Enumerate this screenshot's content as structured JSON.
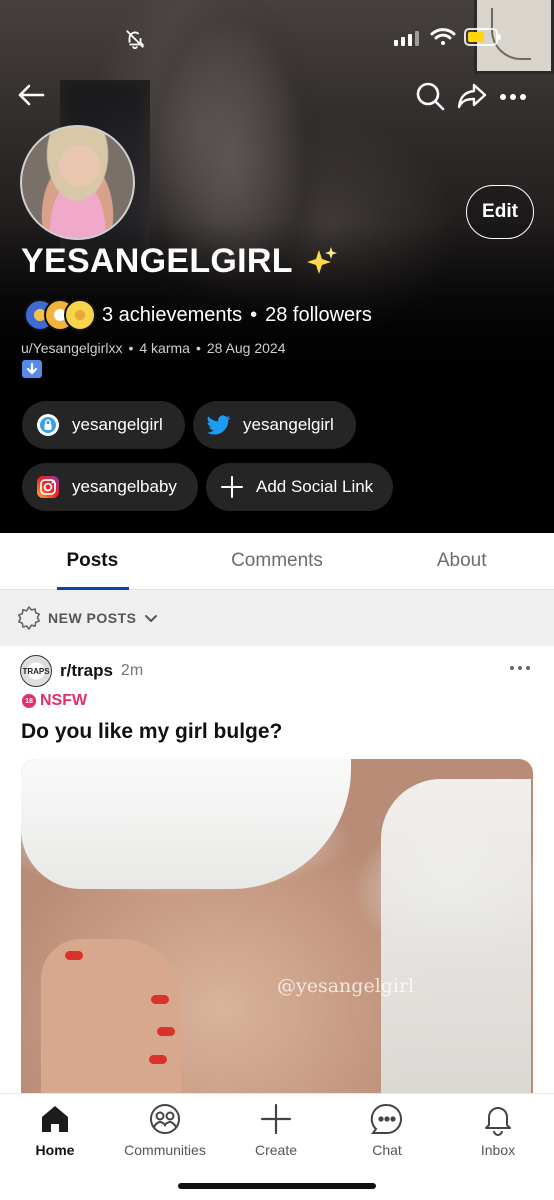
{
  "status_bar": {
    "icons": [
      "bell-slash-icon",
      "signal-icon",
      "wifi-icon",
      "battery-charging-icon"
    ]
  },
  "header": {
    "nav_icons": [
      "back-arrow-icon",
      "search-icon",
      "share-icon",
      "more-icon"
    ],
    "edit_label": "Edit",
    "display_name": "YESANGELGIRL",
    "achievements": "3 achievements",
    "followers": "28 followers",
    "separator": "•",
    "username": "u/Yesangelgirlxx",
    "karma": "4 karma",
    "joined": "28 Aug 2024",
    "social_links": [
      {
        "label": "yesangelgirl",
        "icon": "onlyfans-lock-icon"
      },
      {
        "label": "yesangelgirl",
        "icon": "twitter-bird-icon"
      },
      {
        "label": "yesangelbaby",
        "icon": "instagram-icon"
      },
      {
        "label": "Add Social Link",
        "icon": "plus-icon"
      }
    ]
  },
  "tabs": [
    {
      "label": "Posts",
      "active": true
    },
    {
      "label": "Comments",
      "active": false
    },
    {
      "label": "About",
      "active": false
    }
  ],
  "sort": {
    "label": "NEW POSTS"
  },
  "post": {
    "subreddit": "r/traps",
    "sub_avatar_text": "TRAPS",
    "time": "2m",
    "nsfw_label": "NSFW",
    "title": "Do you like my girl bulge?",
    "watermark": "@yesangelgirl"
  },
  "bottom_nav": [
    {
      "label": "Home",
      "icon": "home-icon",
      "active": true
    },
    {
      "label": "Communities",
      "icon": "communities-icon",
      "active": false
    },
    {
      "label": "Create",
      "icon": "plus-icon",
      "active": false
    },
    {
      "label": "Chat",
      "icon": "chat-bubble-icon",
      "active": false
    },
    {
      "label": "Inbox",
      "icon": "bell-icon",
      "active": false
    }
  ],
  "colors": {
    "accent": "#0a45a8",
    "nsfw": "#e0306b",
    "chip_bg": "#252525"
  }
}
